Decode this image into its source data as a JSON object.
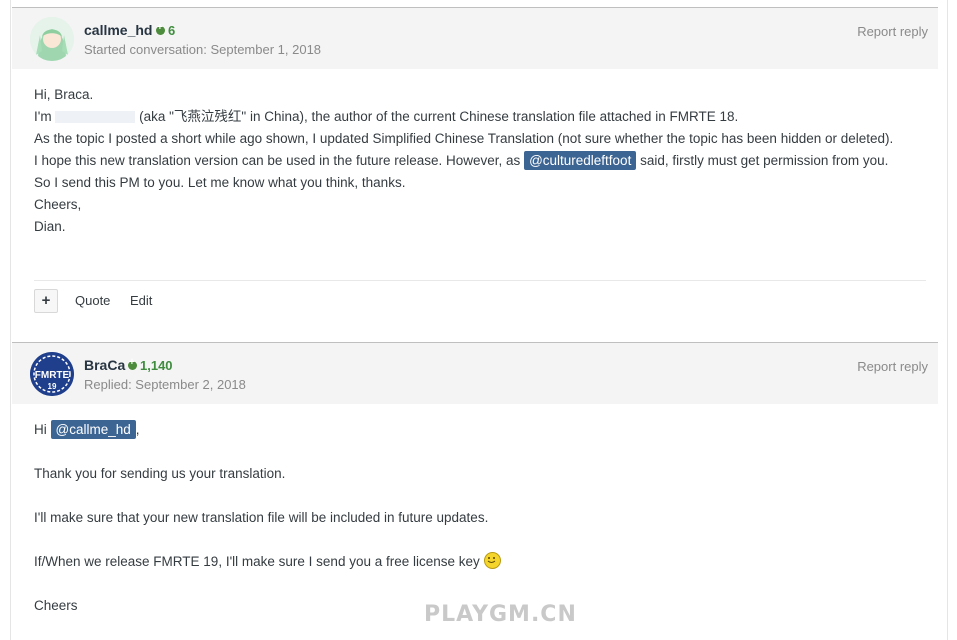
{
  "post1": {
    "author": "callme_hd",
    "reputation": "6",
    "meta": "Started conversation: September 1, 2018",
    "report": "Report reply",
    "lines": {
      "l1": "Hi, Braca.",
      "l2a": "I'm",
      "l2b": "(aka \"飞燕泣残红\" in China), the author of the current Chinese translation file attached in FMRTE 18.",
      "l3": "As the topic I posted a short while ago shown, I updated Simplified Chinese Translation (not sure whether the topic has been hidden or deleted).",
      "l4a": "I hope this new translation version can be used in the future release. However, as",
      "l4mention": "@culturedleftfoot",
      "l4b": "said, firstly must get permission from you.",
      "l5": "So I send this PM to you. Let me know what you think, thanks.",
      "l6": "Cheers,",
      "l7": "Dian."
    },
    "toolbar": {
      "plus": "+",
      "quote": "Quote",
      "edit": "Edit"
    }
  },
  "post2": {
    "author": "BraCa",
    "reputation": "1,140",
    "meta": "Replied: September 2, 2018",
    "report": "Report reply",
    "avatar_text_top": "FMRTE",
    "avatar_text_bottom": "19",
    "lines": {
      "l1a": "Hi",
      "l1mention": "@callme_hd",
      "l1b": ",",
      "l2": "Thank you for sending us your translation.",
      "l3": "I'll make sure that your new translation file will be included in future updates.",
      "l4": "If/When we release FMRTE 19, I'll make sure I send you a free license key",
      "l5": "Cheers"
    }
  },
  "watermark": "PLAYGM.CN",
  "colors": {
    "mention_bg": "#3d6594",
    "rep_green": "#4d8c3c",
    "header_bg": "#f4f4f4"
  }
}
